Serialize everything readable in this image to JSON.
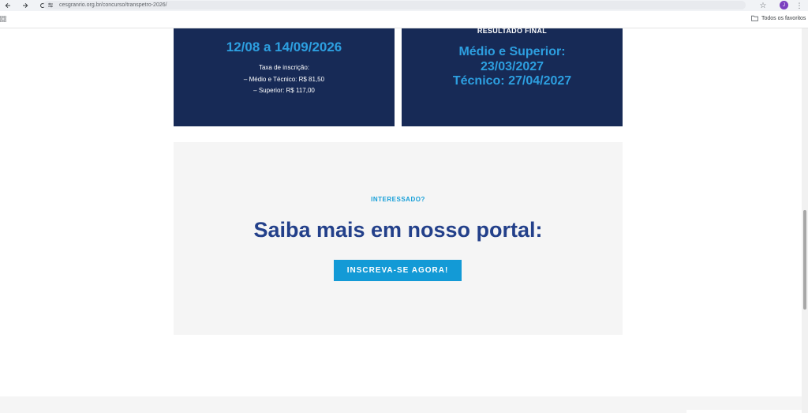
{
  "browser": {
    "url": "cesgranrio.org.br/concurso/transpetro-2026/",
    "avatar_letter": "J",
    "bookmarks_folder": "Todos os favoritos"
  },
  "cards": {
    "left": {
      "dates": "12/08 a 14/09/2026",
      "fee_title": "Taxa de inscrição:",
      "fee_line1": "– Médio e Técnico: R$ 81,50",
      "fee_line2": "– Superior: R$ 117,00"
    },
    "right": {
      "heading": "RESULTADO FINAL",
      "line1": "Médio e Superior:",
      "line2": "23/03/2027",
      "line3": "Técnico: 27/04/2027"
    }
  },
  "cta": {
    "kicker": "INTERESSADO?",
    "title": "Saiba mais em nosso portal:",
    "button": "INSCREVA-SE AGORA!"
  },
  "colors": {
    "card_bg": "#172a56",
    "accent_blue": "#2d9fe0",
    "title_blue": "#23408a",
    "button_bg": "#139ad6"
  }
}
